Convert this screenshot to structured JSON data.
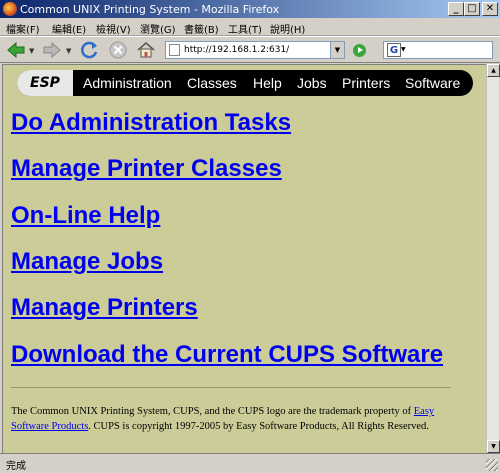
{
  "window": {
    "title": "Common UNIX Printing System - Mozilla Firefox",
    "minimize": "_",
    "maximize": "□",
    "close": "✕"
  },
  "menu": [
    "檔案(F)",
    "編輯(E)",
    "檢視(V)",
    "瀏覽(G)",
    "書籤(B)",
    "工具(T)",
    "說明(H)"
  ],
  "toolbar": {
    "url": "http://192.168.1.2:631/",
    "search_icon_letter": "G"
  },
  "cups_nav": {
    "logo": "ESP",
    "items": [
      "Administration",
      "Classes",
      "Help",
      "Jobs",
      "Printers",
      "Software"
    ]
  },
  "links": [
    "Do Administration Tasks",
    "Manage Printer Classes",
    "On-Line Help",
    "Manage Jobs",
    "Manage Printers",
    "Download the Current CUPS Software"
  ],
  "footer": {
    "text_before": "The Common UNIX Printing System, CUPS, and the CUPS logo are the trademark property of ",
    "link": "Easy Software Products",
    "text_after": ". CUPS is copyright 1997-2005 by Easy Software Products, All Rights Reserved."
  },
  "status": "完成"
}
